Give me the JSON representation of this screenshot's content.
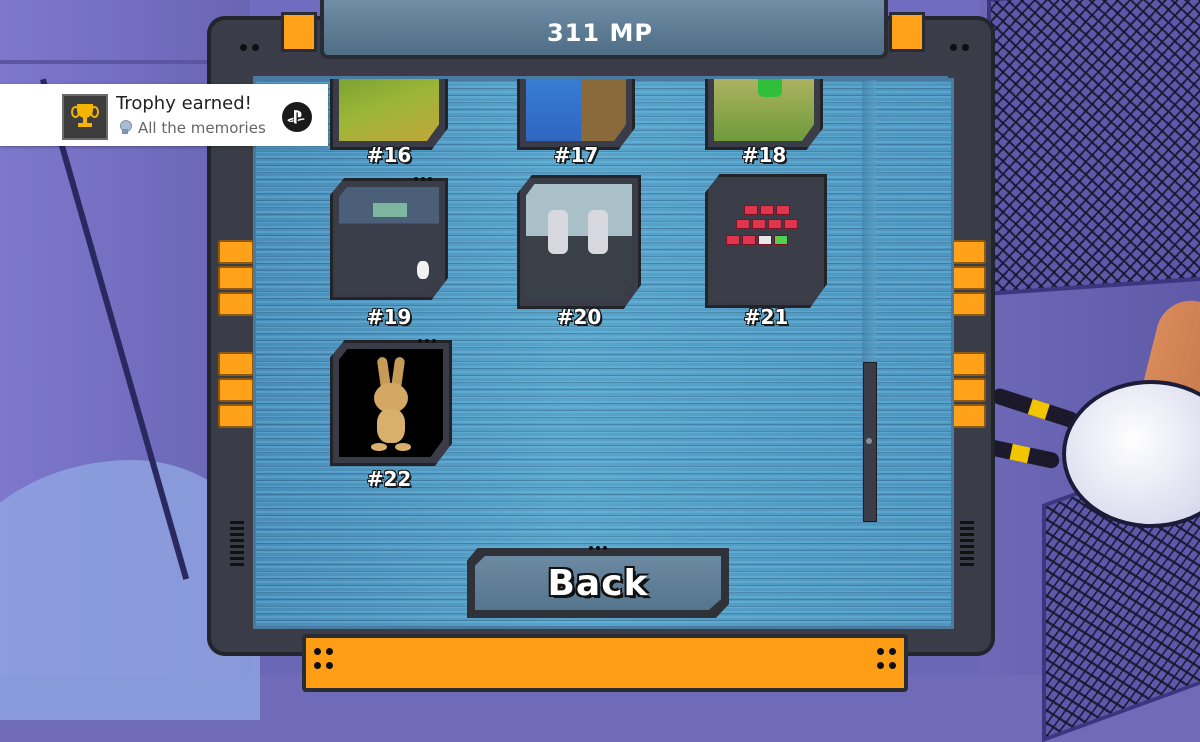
{
  "header": {
    "mp_label": "311 MP"
  },
  "gallery": {
    "items": [
      {
        "label": "#16",
        "image": "grass-scene"
      },
      {
        "label": "#17",
        "image": "blue-crates-scene"
      },
      {
        "label": "#18",
        "image": "character-yard-scene"
      },
      {
        "label": "#19",
        "image": "arena-scene"
      },
      {
        "label": "#20",
        "image": "rabbit-robots-scene"
      },
      {
        "label": "#21",
        "image": "tile-grid-scene"
      },
      {
        "label": "#22",
        "image": "rabbit-character"
      }
    ]
  },
  "back_button": {
    "label": "Back"
  },
  "notification": {
    "title": "Trophy earned!",
    "trophy_name": "All the memories",
    "icon": "trophy-icon",
    "grade_icon": "silver-trophy-icon",
    "platform_icon": "playstation-icon"
  },
  "colors": {
    "accent_orange": "#ffa21a",
    "frame": "#3a3d47",
    "screen": "#5aa3c9"
  }
}
